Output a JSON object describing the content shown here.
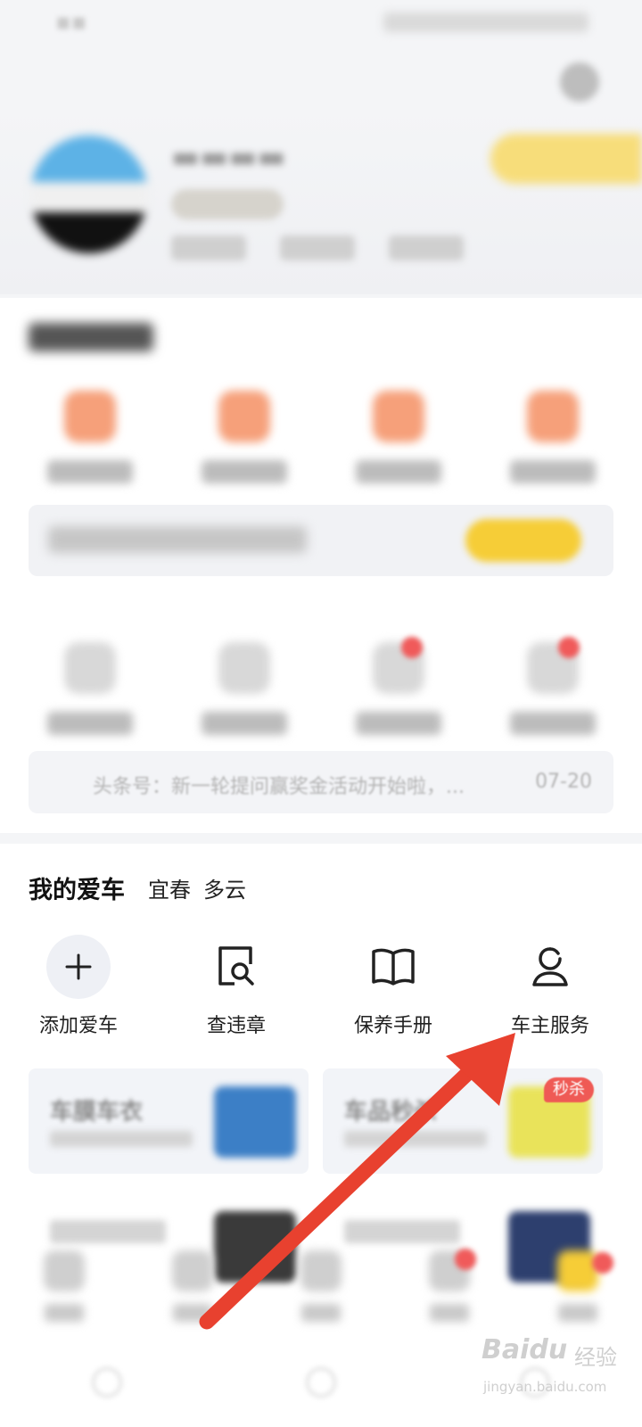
{
  "news": {
    "text": "头条号：新一轮提问赢奖金活动开始啦，...",
    "date": "07-20"
  },
  "my_car": {
    "title": "我的爱车",
    "city": "宜春",
    "weather": "多云",
    "actions": [
      {
        "label": "添加爱车",
        "icon": "plus-icon"
      },
      {
        "label": "查违章",
        "icon": "document-search-icon"
      },
      {
        "label": "保养手册",
        "icon": "book-icon"
      },
      {
        "label": "车主服务",
        "icon": "user-icon"
      }
    ]
  },
  "promos": [
    {
      "title": "车膜车衣"
    },
    {
      "title": "车品秒杀",
      "badge": "秒杀"
    }
  ],
  "annotation": {
    "color": "#e8412f"
  },
  "watermark": {
    "logo": "Baidu",
    "cn": "经验",
    "url": "jingyan.baidu.com"
  }
}
